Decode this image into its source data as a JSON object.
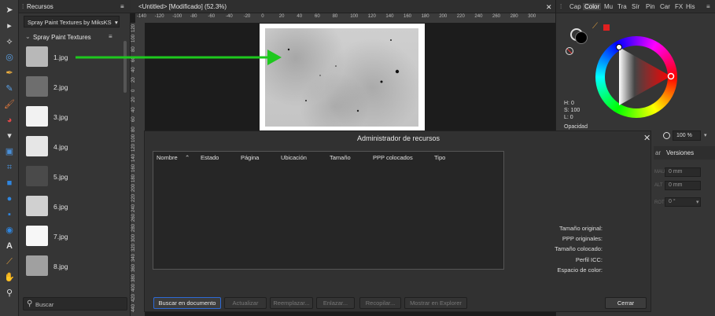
{
  "tools": {
    "icons": [
      "move-tool",
      "node-tool",
      "corner-tool",
      "color-picker-tool",
      "pen-tool",
      "pencil-tool",
      "paint-brush-tool",
      "fill-tool",
      "gradient-tool",
      "place-image-tool",
      "crop-tool",
      "rectangle-tool",
      "ellipse-tool",
      "rounded-rect-tool",
      "donut-tool",
      "artistic-text-tool",
      "eyedropper-tool",
      "hand-tool",
      "zoom-tool"
    ]
  },
  "resources_panel": {
    "tab_label": "Recursos",
    "dropdown_value": "Spray Paint Textures by MiksKS",
    "group_label": "Spray Paint Textures",
    "items": [
      {
        "label": "1.jpg",
        "tone": "#b8b8b8"
      },
      {
        "label": "2.jpg",
        "tone": "#6e6e6e"
      },
      {
        "label": "3.jpg",
        "tone": "#f2f2f2"
      },
      {
        "label": "4.jpg",
        "tone": "#e6e6e6"
      },
      {
        "label": "5.jpg",
        "tone": "#4a4a4a"
      },
      {
        "label": "6.jpg",
        "tone": "#d0d0d0"
      },
      {
        "label": "7.jpg",
        "tone": "#f7f7f7"
      },
      {
        "label": "8.jpg",
        "tone": "#a0a0a0"
      }
    ],
    "search_placeholder": "Buscar"
  },
  "document": {
    "tab_title": "<Untitled> [Modificado] (52.3%)",
    "hruler_ticks": [
      "-140",
      "-120",
      "-100",
      "-80",
      "-60",
      "-40",
      "-20",
      "0",
      "20",
      "40",
      "60",
      "80",
      "100",
      "120",
      "140",
      "160",
      "180",
      "200",
      "220",
      "240",
      "260",
      "280",
      "300"
    ],
    "vruler_ticks": [
      "120",
      "100",
      "80",
      "60",
      "40",
      "20",
      "0",
      "20",
      "40",
      "60",
      "80",
      "100",
      "120",
      "140",
      "160",
      "180",
      "200",
      "220",
      "240",
      "260",
      "280",
      "300",
      "320",
      "340",
      "360",
      "380",
      "400",
      "420",
      "440"
    ]
  },
  "right_panel": {
    "tabs": [
      "Cap",
      "Color",
      "Mu",
      "Tra",
      "Sír",
      "Pin",
      "Car",
      "FX",
      "His"
    ],
    "active_tab": "Color",
    "hsl": {
      "h": "H: 0",
      "s": "S: 100",
      "l": "L: 0"
    },
    "opacity_label": "Opacidad",
    "opacity_value": "100 %",
    "versions_tab": "Versiones",
    "tab_fragment": "ar",
    "field_values": [
      "0 mm",
      "0 mm",
      "0 °"
    ],
    "field_labels": [
      "MAU",
      "ALT",
      "ROT"
    ]
  },
  "dialog": {
    "title": "Administrador de recursos",
    "columns": [
      "Nombre",
      "Estado",
      "Página",
      "Ubicación",
      "Tamaño",
      "PPP colocados",
      "Tipo"
    ],
    "properties": [
      "Tamaño original:",
      "PPP originales:",
      "Tamaño colocado:",
      "Perfil ICC:",
      "Espacio de color:"
    ],
    "buttons": {
      "find": "Buscar en documento",
      "update": "Actualizar",
      "replace": "Reemplazar...",
      "link": "Enlazar...",
      "embed": "Recopilar...",
      "show": "Mostrar en Explorer",
      "close": "Cerrar"
    }
  },
  "colors": {
    "arrow": "#1ec81e",
    "accent": "#2d6ad6"
  }
}
